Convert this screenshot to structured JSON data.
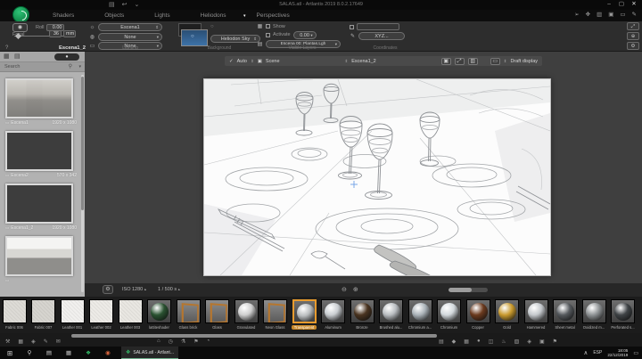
{
  "window": {
    "title": "SALAS.atl - Artlantis 2019 8.0.2.17649",
    "minimize": "–",
    "maximize": "▢",
    "close": "✕",
    "titlebar_icons": [
      {
        "name": "document-icon",
        "glyph": "▤"
      },
      {
        "name": "undo-icon",
        "glyph": "↩"
      },
      {
        "name": "more-icon",
        "glyph": "⌄"
      }
    ]
  },
  "menubar": {
    "items": [
      {
        "label": "Shaders"
      },
      {
        "label": "Objects"
      },
      {
        "label": "Lights"
      },
      {
        "label": "Heliodons"
      },
      {
        "label": "Perspectives",
        "active": true
      }
    ],
    "active_caret": "▾",
    "toolbar_icons": [
      {
        "name": "cursor-icon",
        "glyph": "➢"
      },
      {
        "name": "move-icon",
        "glyph": "✥"
      },
      {
        "name": "duplicate-icon",
        "glyph": "▥"
      },
      {
        "name": "catalog-icon",
        "glyph": "▣"
      },
      {
        "name": "frame-icon",
        "glyph": "▭"
      },
      {
        "name": "edit-icon",
        "glyph": "✎"
      }
    ]
  },
  "inspector": {
    "help": "?",
    "camera": {
      "button_icon": "◉",
      "roll_label": "Roll",
      "roll_value": "0.00",
      "focal_label": "Focal",
      "focal_value": "36",
      "focal_unit": "mm",
      "perspective_name": "Escena1_2"
    },
    "lighting": {
      "rows": [
        {
          "name": "sun-icon",
          "glyph": "☼",
          "value": "Escena1",
          "arrow": "⇕"
        },
        {
          "name": "bulb-icon",
          "glyph": "◍",
          "value": "None",
          "arrow": "▾"
        },
        {
          "name": "neon-icon",
          "glyph": "▭",
          "value": "None",
          "arrow": "▾"
        }
      ],
      "label": "Lighting"
    },
    "background": {
      "dropdown": "Heliodon Sky",
      "arrow": "⇕",
      "label": "Background"
    },
    "layers": {
      "grid_icon": "▦",
      "show_label": "Show",
      "activate_label": "Activate",
      "activate_value": "0.00",
      "activate_arrow": "▾",
      "layers_icon": "▤",
      "layers_value": "Escena 00: Plantas.Lgh",
      "layers_arrow": "▾",
      "label": "Visible Layers"
    },
    "coordinates": {
      "pencil_icon": "✎",
      "button": "XYZ...",
      "label": "Coordinates"
    },
    "side_buttons": [
      {
        "name": "expand-icon",
        "glyph": "⤢"
      },
      {
        "name": "target-icon",
        "glyph": "⊕"
      },
      {
        "name": "settings-icon",
        "glyph": "⚙"
      }
    ]
  },
  "viewport_bar": {
    "auto_label": "Auto",
    "check": "✓",
    "scene_icon": "▣",
    "scene_label": "Scene",
    "camera_arrow": "⇕",
    "camera_value": "Escena1_2",
    "view_icons": [
      {
        "name": "update-view-icon",
        "glyph": "▣"
      },
      {
        "name": "fit-view-icon",
        "glyph": "⤢"
      },
      {
        "name": "preview-icon",
        "glyph": "▥"
      }
    ],
    "display_icon": "▭",
    "display_arrow": "⇕",
    "display_value": "Draft display"
  },
  "sidebar": {
    "view_icons": [
      {
        "name": "grid-view-icon",
        "glyph": "▦"
      },
      {
        "name": "list-view-icon",
        "glyph": "▤"
      }
    ],
    "toolbar_button": "⏺",
    "search_label": "Search",
    "search_icon": "⚲",
    "filter_icon": "▾",
    "item_icon": "▭",
    "items": [
      {
        "name": "Escena1",
        "size": "1920 x 1080",
        "cls": "thumb-render"
      },
      {
        "name": "Escena2",
        "size": "570 x 342",
        "cls": "thumb-dark"
      },
      {
        "name": "Escena1_2",
        "size": "1920 x 1080",
        "cls": "thumb-dark"
      },
      {
        "name": "",
        "size": "",
        "cls": "thumb-photo"
      }
    ]
  },
  "isobar": {
    "gear_icon": "⚙",
    "iso_value": "ISO  1280",
    "iso_stepper": "▴",
    "shutter_value": "1 / 500 s",
    "shutter_stepper": "▴",
    "icons": [
      {
        "name": "zoom-out-icon",
        "glyph": "⊖"
      },
      {
        "name": "zoom-in-icon",
        "glyph": "⊕"
      }
    ],
    "progress_percent": 60
  },
  "materials": {
    "items": [
      {
        "label": "Fabric 006",
        "kind": "flat",
        "color": "#dddbd6"
      },
      {
        "label": "Fabric 007",
        "kind": "flat",
        "color": "#d6d4cf"
      },
      {
        "label": "Leather 001",
        "kind": "flat",
        "color": "#f1f0ee"
      },
      {
        "label": "Leather 002",
        "kind": "flat",
        "color": "#edebe7"
      },
      {
        "label": "Leather 003",
        "kind": "flat",
        "color": "#e9e7e2"
      },
      {
        "label": "lattiteshader",
        "kind": "sphere",
        "color": "#2a5231"
      },
      {
        "label": "Glass brick",
        "kind": "frame",
        "color": "#8d8d8d"
      },
      {
        "label": "Glass",
        "kind": "frame",
        "color": "#939393"
      },
      {
        "label": "Granulated",
        "kind": "sphere",
        "color": "#cfcfcf"
      },
      {
        "label": "Neon Glass",
        "kind": "frame",
        "color": "#9a9a9a"
      },
      {
        "label": "Transparent",
        "kind": "sphere",
        "color": "#b9bcbe",
        "selected": true
      },
      {
        "label": "Aluminum",
        "kind": "sphere",
        "color": "#c9cdd1"
      },
      {
        "label": "Bronze",
        "kind": "sphere",
        "color": "#4a3420"
      },
      {
        "label": "Brushed alu...",
        "kind": "sphere",
        "color": "#b9bdc1"
      },
      {
        "label": "Chromium a...",
        "kind": "sphere",
        "color": "#aab2b8"
      },
      {
        "label": "Chromium",
        "kind": "sphere",
        "color": "#d2d8dc"
      },
      {
        "label": "Copper",
        "kind": "sphere",
        "color": "#6b3a1e"
      },
      {
        "label": "Gold",
        "kind": "sphere",
        "color": "#c99a2e"
      },
      {
        "label": "Hammered",
        "kind": "sphere",
        "color": "#c4c8cc"
      },
      {
        "label": "Sheet metal",
        "kind": "sphere",
        "color": "#55595d"
      },
      {
        "label": "Oxidized m...",
        "kind": "sphere",
        "color": "#8e9294"
      },
      {
        "label": "Perforated s...",
        "kind": "sphere",
        "color": "#3f4346"
      }
    ]
  },
  "catbar": {
    "left_icons": [
      {
        "name": "tools-icon",
        "glyph": "⚒"
      },
      {
        "name": "grid-icon",
        "glyph": "▦"
      },
      {
        "name": "diamond-icon",
        "glyph": "◈"
      },
      {
        "name": "pencil-icon",
        "glyph": "✎"
      },
      {
        "name": "mail-icon",
        "glyph": "✉"
      }
    ],
    "mid_icons": [
      {
        "name": "home-icon",
        "glyph": "⌂"
      },
      {
        "name": "clock-icon",
        "glyph": "◷"
      },
      {
        "name": "lab-icon",
        "glyph": "⚗"
      },
      {
        "name": "flag-icon",
        "glyph": "⚑"
      },
      {
        "name": "sphere-icon",
        "glyph": "◔"
      }
    ],
    "right_icons": [
      {
        "name": "category-icon-1",
        "glyph": "▤"
      },
      {
        "name": "category-icon-2",
        "glyph": "◆"
      },
      {
        "name": "category-icon-3",
        "glyph": "▦"
      },
      {
        "name": "category-icon-4",
        "glyph": "●"
      },
      {
        "name": "category-icon-5",
        "glyph": "◫"
      },
      {
        "name": "category-icon-6",
        "glyph": "♨"
      },
      {
        "name": "category-icon-7",
        "glyph": "▧"
      },
      {
        "name": "category-icon-8",
        "glyph": "◈"
      },
      {
        "name": "category-icon-9",
        "glyph": "▣"
      },
      {
        "name": "category-icon-10",
        "glyph": "⚑"
      }
    ]
  },
  "taskbar": {
    "start_icon": "⊞",
    "icons": [
      {
        "name": "taskbar-search-icon",
        "glyph": "⚲",
        "color": "#cfcfcf"
      },
      {
        "name": "task-view-icon",
        "glyph": "▤",
        "color": "#cfcfcf"
      },
      {
        "name": "calculator-icon",
        "glyph": "▦",
        "color": "#bdbdbd"
      },
      {
        "name": "app-icon-green",
        "glyph": "❖",
        "color": "#34c06a"
      },
      {
        "name": "browser-icon",
        "glyph": "◉",
        "color": "#d9663f"
      }
    ],
    "active_app_icon": "❖",
    "active_app_label": "SALAS.atl - Artlant...",
    "tray_chevron": "∧",
    "language": "ESP",
    "time": "18:05",
    "date": "22/12/2019",
    "notification_icon": "▭"
  },
  "colors": {
    "accent_orange": "#e89b2e",
    "selection_blue": "#3d72a8",
    "artlantis_green": "#128a4a"
  }
}
